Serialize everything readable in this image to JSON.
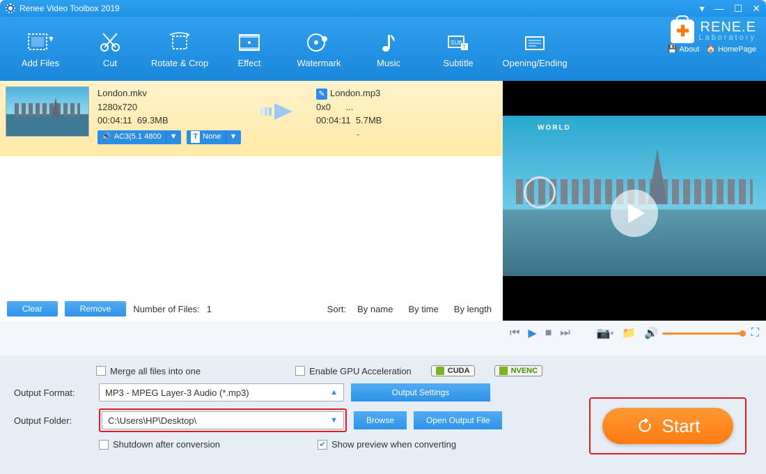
{
  "title": "Renee Video Toolbox 2019",
  "brand": {
    "name": "RENE.E",
    "sub": "Laboratory",
    "about": "About",
    "home": "HomePage"
  },
  "toolbar": [
    {
      "label": "Add Files"
    },
    {
      "label": "Cut"
    },
    {
      "label": "Rotate & Crop"
    },
    {
      "label": "Effect"
    },
    {
      "label": "Watermark"
    },
    {
      "label": "Music"
    },
    {
      "label": "Subtitle"
    },
    {
      "label": "Opening/Ending"
    }
  ],
  "file": {
    "src": {
      "name": "London.mkv",
      "res": "1280x720",
      "dur": "00:04:11",
      "size": "69.3MB",
      "audio": "AC3(5.1 4800",
      "subtitle": "None"
    },
    "dst": {
      "name": "London.mp3",
      "res": "0x0",
      "res_extra": "...",
      "dur": "00:04:11",
      "size": "5.7MB",
      "dash": "-"
    }
  },
  "preview_tag": "WORLD",
  "filebar": {
    "clear": "Clear",
    "remove": "Remove",
    "count_label": "Number of Files:",
    "count": "1",
    "sort_label": "Sort:",
    "by_name": "By name",
    "by_time": "By time",
    "by_length": "By length"
  },
  "settings": {
    "merge": "Merge all files into one",
    "gpu": "Enable GPU Acceleration",
    "cuda": "CUDA",
    "nvenc": "NVENC",
    "format_label": "Output Format:",
    "format_value": "MP3 - MPEG Layer-3 Audio (*.mp3)",
    "output_settings": "Output Settings",
    "folder_label": "Output Folder:",
    "folder_value": "C:\\Users\\HP\\Desktop\\",
    "browse": "Browse",
    "open": "Open Output File",
    "shutdown": "Shutdown after conversion",
    "show_preview": "Show preview when converting",
    "start": "Start"
  }
}
